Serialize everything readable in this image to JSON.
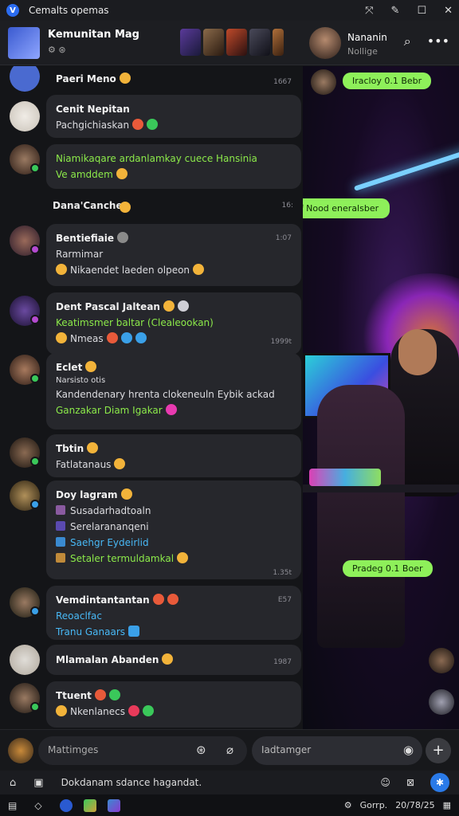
{
  "window": {
    "title": "Cemalts opemas",
    "controls": [
      "⤧",
      "✎",
      "☐",
      "✕"
    ]
  },
  "header": {
    "group_name": "Kemunitan Mag",
    "group_sub": "⚙ ⊛",
    "peer_name": "Nananin",
    "peer_sub": "Nollige",
    "icons": [
      "search-icon",
      "more-icon"
    ]
  },
  "chats": [
    {
      "name": "Paeri Meno",
      "time": "1667",
      "lines": []
    },
    {
      "name": "Cenit Nepitan",
      "time": "",
      "lines": [
        {
          "text": "Pachgichiaskan",
          "cls": "txt"
        }
      ]
    },
    {
      "name": "",
      "time": "",
      "lines": [
        {
          "text": "Niamikaqare ardanlamkay cuece Hansinia",
          "cls": "green"
        },
        {
          "text": "Ve amddem",
          "cls": "green"
        }
      ]
    },
    {
      "name": "Dana'Canches",
      "time": "16:",
      "lines": []
    },
    {
      "name": "Bentiefiaie",
      "time": "1:07",
      "lines": [
        {
          "text": "Rarmimar",
          "cls": "txt"
        },
        {
          "text": "Nikaendet laeden olpeon",
          "cls": "txt"
        }
      ]
    },
    {
      "name": "Dent Pascal Jaltean",
      "time": "1999t",
      "lines": [
        {
          "text": "Keatimsmer baltar (Clealeookan)",
          "cls": "green"
        },
        {
          "text": "Nmeas",
          "cls": "txt"
        }
      ]
    },
    {
      "name": "Eclet",
      "time": "",
      "lines": [
        {
          "text": "Narsisto otis",
          "cls": "txt"
        },
        {
          "text": "Kandendenary hrenta clokeneuln Eybik ackad",
          "cls": "txt"
        },
        {
          "text": "Ganzakar  Diam Igakar",
          "cls": "green"
        }
      ]
    },
    {
      "name": "Tbtin",
      "time": "",
      "lines": [
        {
          "text": "Fatlatanaus",
          "cls": "txt"
        }
      ]
    },
    {
      "name": "Doy lagram",
      "time": "1.35t",
      "lines": [
        {
          "text": "Susadarhadtoaln",
          "cls": "txt"
        },
        {
          "text": "Serelarananqeni",
          "cls": "txt"
        },
        {
          "text": "Saehgr Eydeirlid",
          "cls": "blue"
        },
        {
          "text": "Setaler termuldamkal",
          "cls": "green"
        }
      ]
    },
    {
      "name": "Vemdintantantan",
      "time": "E57",
      "lines": [
        {
          "text": "Reoaclfac",
          "cls": "blue"
        },
        {
          "text": "Tranu Ganaars",
          "cls": "blue"
        }
      ]
    },
    {
      "name": "Mlamalan Abanden",
      "time": "1987",
      "lines": []
    },
    {
      "name": "Ttuent",
      "time": "",
      "lines": [
        {
          "text": "Nkenlanecs",
          "cls": "txt"
        }
      ]
    }
  ],
  "right_panel": {
    "bubbles": [
      "Iracloy 0.1 Bebr",
      "Vs f Nood eneralsber",
      "Pradeg 0.1 Boer"
    ]
  },
  "composer": {
    "input1_placeholder": "Mattimges",
    "input2_placeholder": "Iadtamger"
  },
  "statusbar": {
    "text": "Dokdanam sdance hagandat."
  },
  "taskbar": {
    "right_text": "Gorrp.",
    "time": "20/78/25"
  },
  "colors": {
    "accent_green": "#8cea4a",
    "accent_blue": "#48b8f5",
    "send_bubble": "#8ef05a"
  }
}
